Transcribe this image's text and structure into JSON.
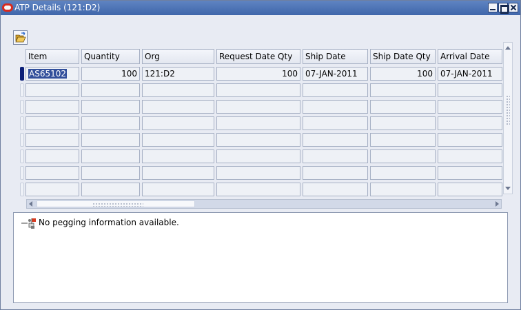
{
  "window": {
    "title": "ATP Details (121:D2)"
  },
  "toolbar": {
    "open_icon": "folder-open-icon"
  },
  "table": {
    "columns": [
      "Item",
      "Quantity",
      "Org",
      "Request Date Qty",
      "Ship Date",
      "Ship Date Qty",
      "Arrival Date"
    ],
    "rows": [
      [
        "AS65102",
        "100",
        "121:D2",
        "100",
        "07-JAN-2011",
        "100",
        "07-JAN-2011"
      ]
    ]
  },
  "pegging": {
    "message": "No pegging information available."
  },
  "colors": {
    "titlebar": "#4a70b3",
    "selection": "#324f9b",
    "background": "#e8ebf3"
  }
}
